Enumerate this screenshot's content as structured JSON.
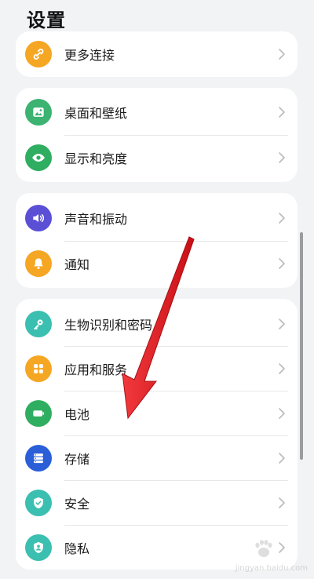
{
  "header": {
    "title": "设置"
  },
  "items": {
    "more_connections": {
      "label": "更多连接",
      "icon": "link-icon",
      "color": "#f5a623"
    },
    "desktop_wallpaper": {
      "label": "桌面和壁纸",
      "icon": "image-icon",
      "color": "#3cb371"
    },
    "display_brightness": {
      "label": "显示和亮度",
      "icon": "eye-icon",
      "color": "#2fae61"
    },
    "sound_vibration": {
      "label": "声音和振动",
      "icon": "speaker-icon",
      "color": "#5b4fd6"
    },
    "notifications": {
      "label": "通知",
      "icon": "bell-icon",
      "color": "#f5a623"
    },
    "biometrics_password": {
      "label": "生物识别和密码",
      "icon": "key-icon",
      "color": "#3bbfb0"
    },
    "apps_services": {
      "label": "应用和服务",
      "icon": "apps-grid-icon",
      "color": "#f5a623"
    },
    "battery": {
      "label": "电池",
      "icon": "battery-icon",
      "color": "#2fae61"
    },
    "storage": {
      "label": "存储",
      "icon": "storage-icon",
      "color": "#2a5fd8"
    },
    "security": {
      "label": "安全",
      "icon": "shield-check-icon",
      "color": "#3bbfb0"
    },
    "privacy": {
      "label": "隐私",
      "icon": "shield-person-icon",
      "color": "#3bbfb0"
    }
  },
  "annotation": {
    "arrow_color": "#e3161b"
  },
  "watermark": {
    "text": "jingyan.baidu.com"
  }
}
